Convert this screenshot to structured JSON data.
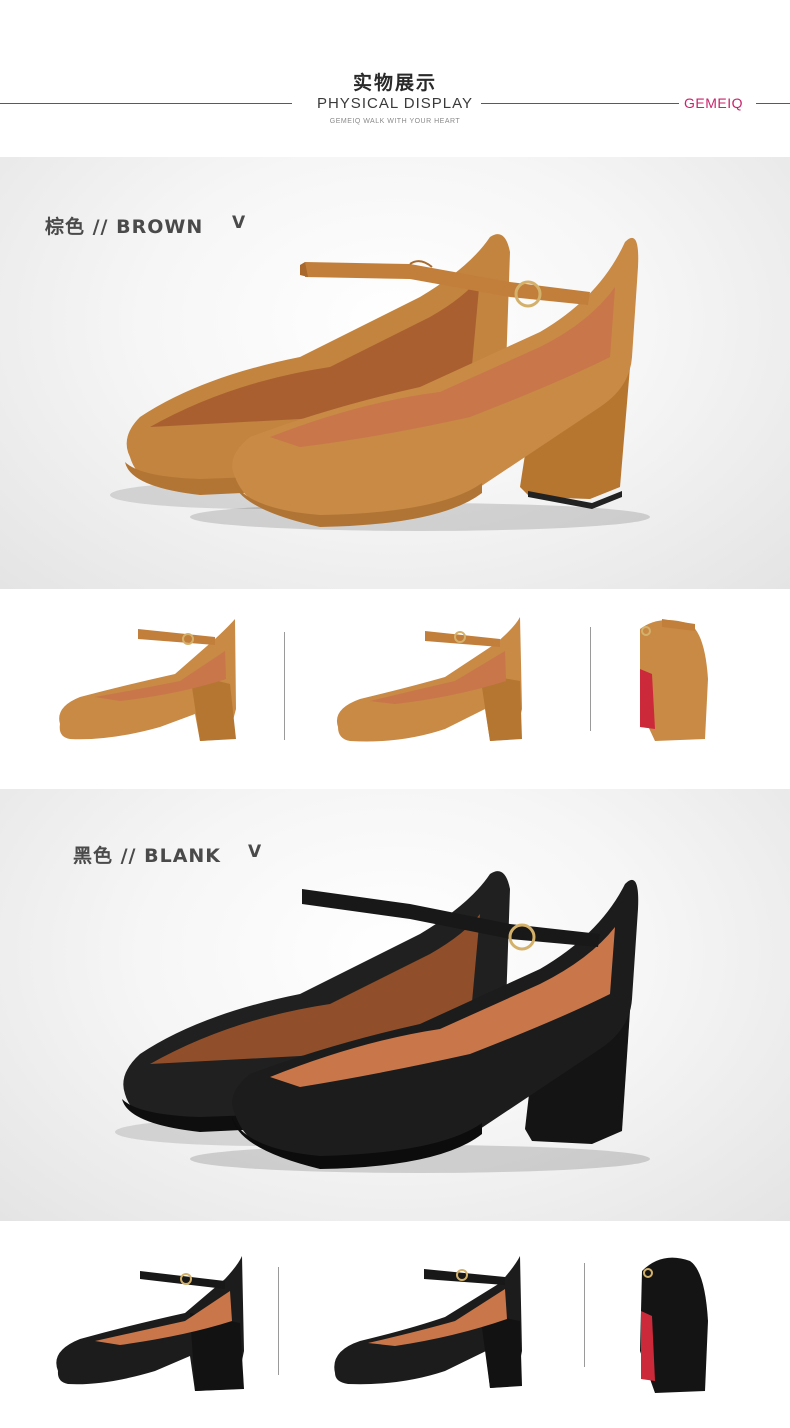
{
  "header": {
    "title_cn": "实物展示",
    "title_en": "PHYSICAL DISPLAY",
    "subtitle": "GEMEIQ WALK WITH YOUR HEART",
    "brand": "GEMEIQ"
  },
  "colors": {
    "brand": "#c8236b",
    "brown_suede": "#c88a45",
    "black_suede": "#1c1c1c",
    "lining": "#c9764a"
  },
  "sections": [
    {
      "label": "棕色 // BROWN",
      "chevron": "V",
      "variant": "brown"
    },
    {
      "label": "黑色 // BLANK",
      "chevron": "V",
      "variant": "black"
    }
  ],
  "icons": {
    "chevron": "chevron-down-icon"
  }
}
